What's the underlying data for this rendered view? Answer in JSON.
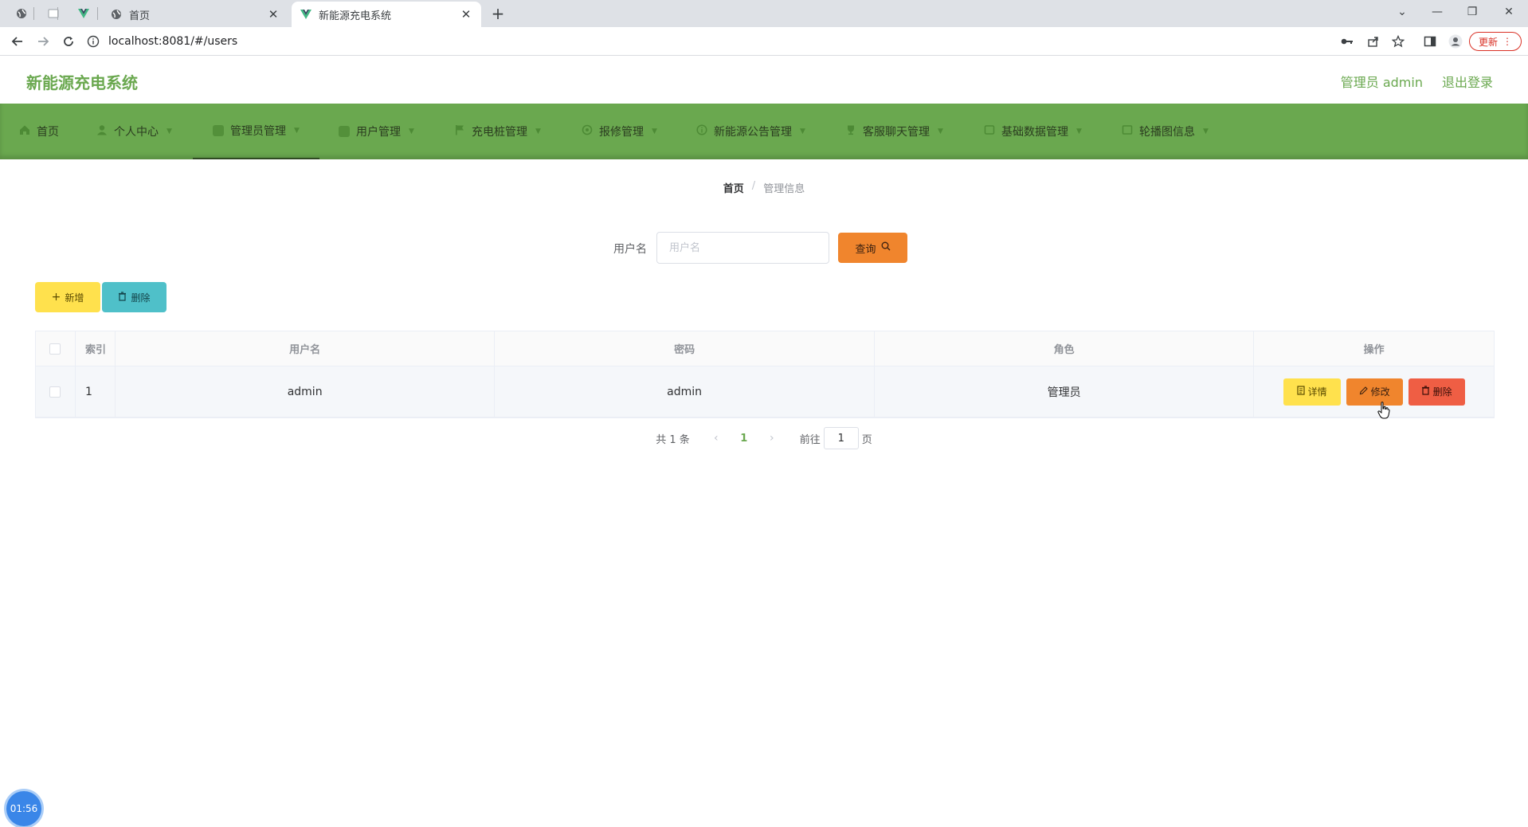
{
  "browser": {
    "tabs": [
      {
        "title": "首页"
      },
      {
        "title": "新能源充电系统"
      }
    ],
    "url": "localhost:8081/#/users",
    "update_label": "更新"
  },
  "header": {
    "brand": "新能源充电系统",
    "admin_label": "管理员 admin",
    "logout_label": "退出登录"
  },
  "nav": {
    "items": [
      {
        "label": "首页"
      },
      {
        "label": "个人中心"
      },
      {
        "label": "管理员管理"
      },
      {
        "label": "用户管理"
      },
      {
        "label": "充电桩管理"
      },
      {
        "label": "报修管理"
      },
      {
        "label": "新能源公告管理"
      },
      {
        "label": "客服聊天管理"
      },
      {
        "label": "基础数据管理"
      },
      {
        "label": "轮播图信息"
      }
    ],
    "active_index": 2,
    "color": "#6aa84f"
  },
  "breadcrumb": {
    "home": "首页",
    "separator": "/",
    "current": "管理信息"
  },
  "search": {
    "label": "用户名",
    "placeholder": "用户名",
    "value": "",
    "query_label": "查询"
  },
  "actions": {
    "add_label": "新增",
    "delete_label": "删除"
  },
  "table": {
    "headers": {
      "index": "索引",
      "username": "用户名",
      "password": "密码",
      "role": "角色",
      "operations": "操作"
    },
    "rows": [
      {
        "index": "1",
        "username": "admin",
        "password": "admin",
        "role": "管理员"
      }
    ],
    "row_actions": {
      "detail": "详情",
      "edit": "修改",
      "delete": "删除"
    }
  },
  "pagination": {
    "total_text": "共 1 条",
    "current_page": "1",
    "goto_prefix": "前往",
    "goto_value": "1",
    "goto_suffix": "页"
  },
  "timer": "01:56",
  "colors": {
    "accent": "#6aa84f",
    "query": "#f0852d",
    "add": "#ffe14d",
    "delete_batch": "#4fc0c9",
    "delete_row": "#ef5e44"
  }
}
